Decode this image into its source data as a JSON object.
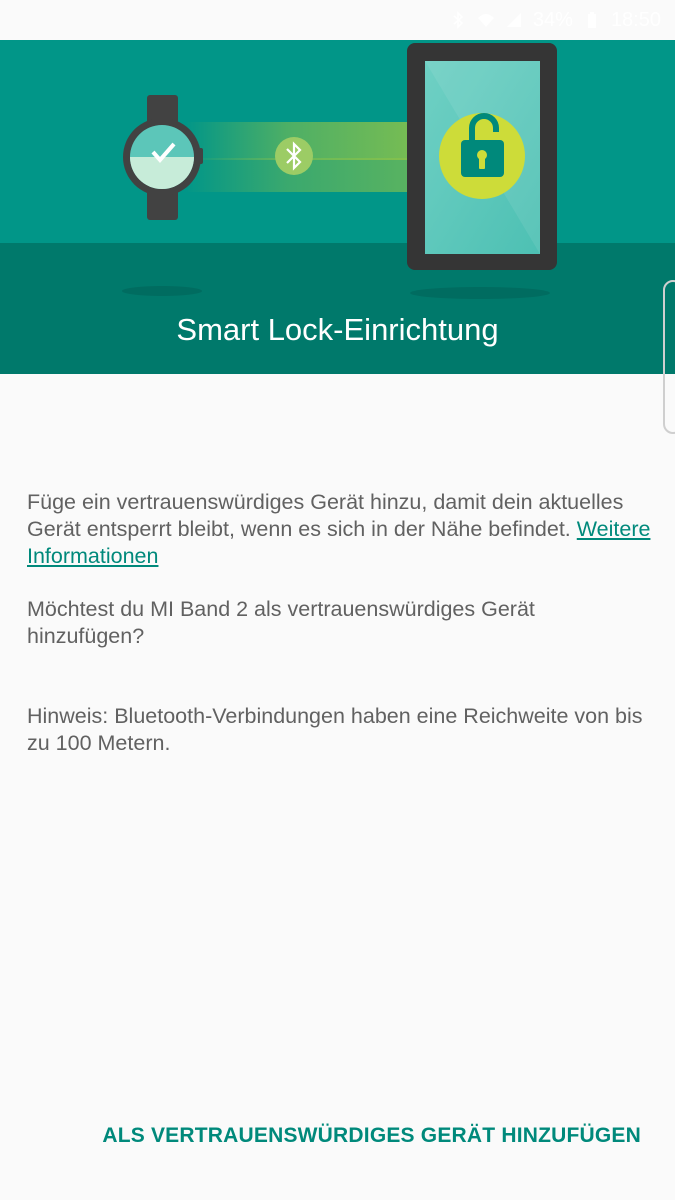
{
  "status_bar": {
    "battery_percent": "34%",
    "time": "18:50",
    "icons": [
      "bluetooth-icon",
      "wifi-icon",
      "signal-icon",
      "battery-icon"
    ]
  },
  "header": {
    "title": "Smart Lock-Einrichtung",
    "illustration": {
      "icons": [
        "smartwatch-icon",
        "bluetooth-icon",
        "tablet-icon",
        "unlocked-padlock-icon"
      ]
    }
  },
  "body": {
    "paragraph1_text": "Füge ein vertrauenswürdiges Gerät hinzu, damit dein aktuelles Gerät entsperrt bleibt, wenn es sich in der Nähe befindet.",
    "paragraph1_link": "Weitere Informationen",
    "paragraph2": "Möchtest du MI Band 2 als vertrauenswürdiges Gerät hinzufügen?",
    "paragraph3": "Hinweis: Bluetooth-Verbindungen haben eine Reichweite von bis zu 100 Metern."
  },
  "actions": {
    "add_trusted_device": "ALS VERTRAUENSWÜRDIGES GERÄT HINZUFÜGEN"
  },
  "colors": {
    "header_teal": "#019688",
    "header_dark_teal": "#00796b",
    "accent": "#00897b",
    "body_text": "#616161",
    "background": "#fafafa"
  }
}
